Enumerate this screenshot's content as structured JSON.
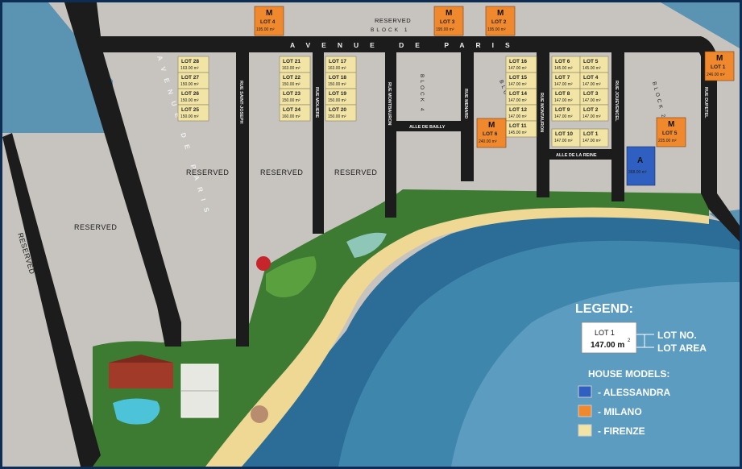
{
  "colors": {
    "road": "#1c1c1c",
    "lot_gray": "#c9c6c1",
    "firenze": "#f1e4a4",
    "milano": "#f0892e",
    "alessandra": "#2f5fc0",
    "sea": "#2b6d96",
    "sand": "#efd893",
    "grass": "#3d7a32",
    "frame": "#0d2d55"
  },
  "roads": {
    "avenue_top": "AVENUE DE PARIS",
    "avenue_side": "AVENUE DE PARIS",
    "streets": [
      "RUE SAINT-JOSEPH",
      "RUE MOLIERE",
      "RUE MONTBAURON",
      "RUE MENARD",
      "RUE MONTAURON",
      "RUE JOUEVENCEL",
      "RUE DUFETEL"
    ],
    "alleys": [
      "ALLE DE BAILLY",
      "ALLE DE LA REINE"
    ]
  },
  "blocks": {
    "block1": "BLOCK 1",
    "block2a": "BLOCK 2",
    "block4": "BLOCK 4",
    "block2b": "BLOCK 2"
  },
  "reserved": {
    "top": "RESERVED",
    "left_strip": "RESERVED",
    "left_big": "RESERVED",
    "col1": "RESERVED",
    "col2": "RESERVED",
    "col3": "RESERVED"
  },
  "lots": {
    "firenze": [
      {
        "id": "LOT 28",
        "area": "163.00 m²"
      },
      {
        "id": "LOT 27",
        "area": "150.00 m²"
      },
      {
        "id": "LOT 26",
        "area": "150.00 m²"
      },
      {
        "id": "LOT 25",
        "area": "150.00 m²"
      },
      {
        "id": "LOT 21",
        "area": "163.00 m²"
      },
      {
        "id": "LOT 22",
        "area": "150.00 m²"
      },
      {
        "id": "LOT 23",
        "area": "150.00 m²"
      },
      {
        "id": "LOT 24",
        "area": "160.00 m²"
      },
      {
        "id": "LOT 17",
        "area": "163.00 m²"
      },
      {
        "id": "LOT 18",
        "area": "150.00 m²"
      },
      {
        "id": "LOT 19",
        "area": "150.00 m²"
      },
      {
        "id": "LOT 20",
        "area": "150.00 m²"
      },
      {
        "id": "LOT 16",
        "area": "147.00 m²"
      },
      {
        "id": "LOT 15",
        "area": "147.00 m²"
      },
      {
        "id": "LOT 14",
        "area": "147.00 m²"
      },
      {
        "id": "LOT 12",
        "area": "147.00 m²"
      },
      {
        "id": "LOT 11",
        "area": "145.00 m²"
      },
      {
        "id": "LOT 6",
        "area": "145.00 m²"
      },
      {
        "id": "LOT 5",
        "area": "145.00 m²"
      },
      {
        "id": "LOT 7",
        "area": "147.00 m²"
      },
      {
        "id": "LOT 4",
        "area": "147.00 m²"
      },
      {
        "id": "LOT 8",
        "area": "147.00 m²"
      },
      {
        "id": "LOT 3",
        "area": "147.00 m²"
      },
      {
        "id": "LOT 9",
        "area": "147.00 m²"
      },
      {
        "id": "LOT 2",
        "area": "147.00 m²"
      },
      {
        "id": "LOT 10",
        "area": "147.00 m²"
      },
      {
        "id": "LOT 1",
        "area": "147.00 m²"
      }
    ],
    "milano": [
      {
        "letter": "M",
        "id": "LOT 4",
        "area": "195.00 m²"
      },
      {
        "letter": "M",
        "id": "LOT 3",
        "area": "195.00 m²"
      },
      {
        "letter": "M",
        "id": "LOT 2",
        "area": "195.00 m²"
      },
      {
        "letter": "M",
        "id": "LOT 1",
        "area": "246.00 m²"
      },
      {
        "letter": "M",
        "id": "LOT 6",
        "area": "240.00 m²"
      },
      {
        "letter": "M",
        "id": "LOT 5",
        "area": "225.00 m²"
      }
    ],
    "alessandra": [
      {
        "letter": "A",
        "area": "368.00 m²"
      }
    ]
  },
  "legend": {
    "title": "LEGEND:",
    "sample_lot": "LOT 1",
    "sample_area": "147.00 m",
    "sample_sup": "2",
    "key_lot": "LOT NO.",
    "key_area": "LOT AREA",
    "models_title": "HOUSE MODELS:",
    "models": [
      {
        "name": "- ALESSANDRA",
        "color": "#2f5fc0"
      },
      {
        "name": "- MILANO",
        "color": "#f0892e"
      },
      {
        "name": "- FIRENZE",
        "color": "#f1e4a4"
      }
    ]
  }
}
